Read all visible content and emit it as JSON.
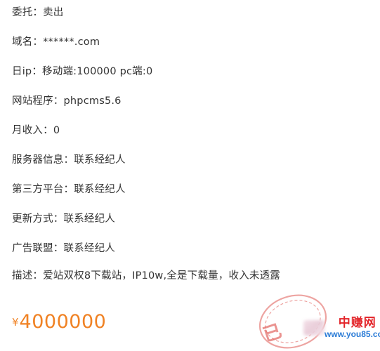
{
  "listing": {
    "fields": [
      {
        "label": "委托：",
        "value": "卖出"
      },
      {
        "label": "域名：",
        "value": "******.com"
      },
      {
        "label": "日ip：",
        "value": "移动端:100000 pc端:0"
      },
      {
        "label": "网站程序：",
        "value": "phpcms5.6"
      },
      {
        "label": "月收入：",
        "value": "0"
      },
      {
        "label": "服务器信息：",
        "value": "联系经纪人"
      },
      {
        "label": "第三方平台：",
        "value": "联系经纪人"
      },
      {
        "label": "更新方式：",
        "value": "联系经纪人"
      },
      {
        "label": "广告联盟：",
        "value": "联系经纪人"
      },
      {
        "label": "描述：",
        "value": "爱站双权8下载站，IP10w,全是下载量，收入未透露"
      }
    ],
    "price": {
      "currency_symbol": "¥",
      "amount": "4000000"
    },
    "stamp_text": "已"
  },
  "watermark": {
    "brand": "中赚网",
    "url": "www.you85.com"
  },
  "colors": {
    "text": "#333333",
    "price": "#f08224",
    "stamp": "#e05a55",
    "watermark_brand": "#e3262b",
    "watermark_url": "#2a7bd6"
  }
}
